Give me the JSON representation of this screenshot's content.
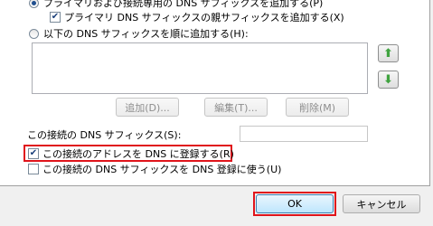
{
  "dns_options": {
    "radio_primary_label": "プライマリおよび接続専用の DNS サフィックスを追加する(P)",
    "check_parent_suffix_label": "プライマリ DNS サフィックスの親サフィックスを追加する(X)",
    "check_parent_suffix_state": "✔",
    "radio_custom_label": "以下の DNS サフィックスを順に追加する(H):",
    "arrow_up": "⬆",
    "arrow_down": "⬇",
    "add_label": "追加(D)...",
    "edit_label": "編集(T)...",
    "delete_label": "削除(M)",
    "connection_suffix_label": "この接続の DNS サフィックス(S):",
    "connection_suffix_value": "",
    "register_address_label": "この接続のアドレスを DNS に登録する(R)",
    "register_address_state": "✔",
    "use_suffix_label": "この接続の DNS サフィックスを DNS 登録に使う(U)",
    "use_suffix_state": ""
  },
  "footer": {
    "ok_label": "OK",
    "cancel_label": "キャンセル"
  },
  "colors": {
    "highlight_red": "#e0141b",
    "arrow_green": "#3fa33f"
  }
}
